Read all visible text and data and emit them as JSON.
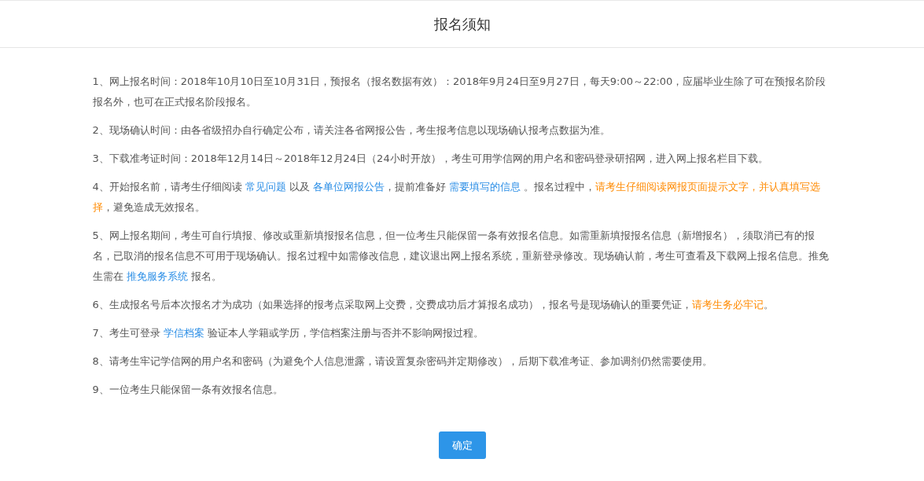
{
  "header": {
    "title": "报名须知"
  },
  "items": [
    {
      "segments": [
        {
          "kind": "text",
          "text": "1、网上报名时间：2018年10月10日至10月31日，预报名（报名数据有效）：2018年9月24日至9月27日，每天9:00～22:00，应届毕业生除了可在预报名阶段报名外，也可在正式报名阶段报名。"
        }
      ]
    },
    {
      "segments": [
        {
          "kind": "text",
          "text": "2、现场确认时间：由各省级招办自行确定公布，请关注各省网报公告，考生报考信息以现场确认报考点数据为准。"
        }
      ]
    },
    {
      "segments": [
        {
          "kind": "text",
          "text": "3、下载准考证时间：2018年12月14日～2018年12月24日（24小时开放），考生可用学信网的用户名和密码登录研招网，进入网上报名栏目下载。"
        }
      ]
    },
    {
      "segments": [
        {
          "kind": "text",
          "text": "4、开始报名前，请考生仔细阅读 "
        },
        {
          "kind": "link",
          "text": "常见问题"
        },
        {
          "kind": "text",
          "text": " 以及 "
        },
        {
          "kind": "link",
          "text": "各单位网报公告"
        },
        {
          "kind": "text",
          "text": "，提前准备好 "
        },
        {
          "kind": "link",
          "text": "需要填写的信息"
        },
        {
          "kind": "text",
          "text": " 。报名过程中，"
        },
        {
          "kind": "warning",
          "text": "请考生仔细阅读网报页面提示文字，并认真填写选择"
        },
        {
          "kind": "text",
          "text": "，避免造成无效报名。"
        }
      ]
    },
    {
      "segments": [
        {
          "kind": "text",
          "text": "5、网上报名期间，考生可自行填报、修改或重新填报报名信息，但一位考生只能保留一条有效报名信息。如需重新填报报名信息（新增报名），须取消已有的报名，已取消的报名信息不可用于现场确认。报名过程中如需修改信息，建议退出网上报名系统，重新登录修改。现场确认前，考生可查看及下载网上报名信息。推免生需在 "
        },
        {
          "kind": "link",
          "text": "推免服务系统"
        },
        {
          "kind": "text",
          "text": " 报名。"
        }
      ]
    },
    {
      "segments": [
        {
          "kind": "text",
          "text": "6、生成报名号后本次报名才为成功（如果选择的报考点采取网上交费，交费成功后才算报名成功），报名号是现场确认的重要凭证，"
        },
        {
          "kind": "warning",
          "text": "请考生务必牢记"
        },
        {
          "kind": "text",
          "text": "。"
        }
      ]
    },
    {
      "segments": [
        {
          "kind": "text",
          "text": "7、考生可登录 "
        },
        {
          "kind": "link",
          "text": "学信档案"
        },
        {
          "kind": "text",
          "text": " 验证本人学籍或学历，学信档案注册与否并不影响网报过程。"
        }
      ]
    },
    {
      "segments": [
        {
          "kind": "text",
          "text": "8、请考生牢记学信网的用户名和密码（为避免个人信息泄露，请设置复杂密码并定期修改），后期下载准考证、参加调剂仍然需要使用。"
        }
      ]
    },
    {
      "segments": [
        {
          "kind": "text",
          "text": "9、一位考生只能保留一条有效报名信息。"
        }
      ]
    }
  ],
  "confirm_button": "确定"
}
